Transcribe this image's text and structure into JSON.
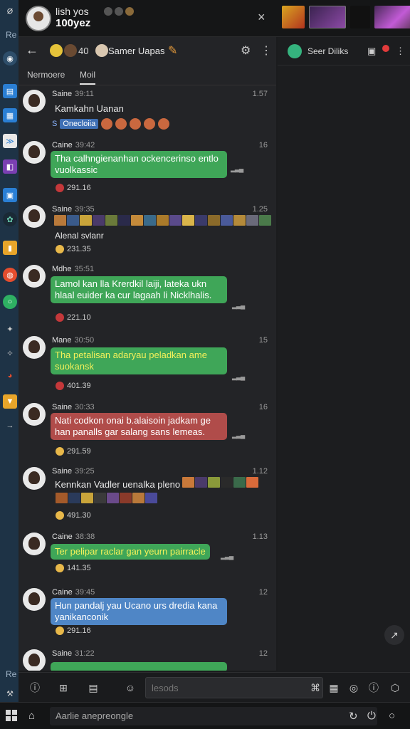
{
  "window": {
    "title": "lish yos",
    "subtitle": "100yez",
    "close_icon": "×"
  },
  "rail": {
    "top_label": "Re",
    "bottom_label": "Re"
  },
  "chat": {
    "back_icon": "←",
    "member_count": "40",
    "title": "Samer Uapas",
    "tabs": [
      "Nermoere",
      "Moil"
    ],
    "settings_icon": "⚙",
    "more_icon": "⋮"
  },
  "messages": [
    {
      "sender": "Saine",
      "time": "39:11",
      "stamp": "1.57",
      "style": "plain",
      "text": "Kamkahn Uanan",
      "tag": "Onecloiia"
    },
    {
      "sender": "Caine",
      "time": "39:42",
      "stamp": "16",
      "style": "green",
      "text": "Tha calhngienanhan ockencerinso entlo vuolkassic",
      "reaction": "291.16"
    },
    {
      "sender": "Saine",
      "time": "39:35",
      "stamp": "1.25",
      "style": "plain",
      "text": "Alenal svlanr",
      "reaction": "231.35"
    },
    {
      "sender": "Mdhe",
      "time": "35:51",
      "stamp": "",
      "style": "green",
      "text": "Lamol kan lla Krerdkil laiji, lateka ukn hlaal euider ka cur lagaah li Nicklhalis.",
      "reaction": "221.10"
    },
    {
      "sender": "Mane",
      "time": "30:50",
      "stamp": "15",
      "style": "green-yellow",
      "text": "Tha petalisan adaryau peladkan ame suokansk",
      "reaction": "401.39"
    },
    {
      "sender": "Saine",
      "time": "30:33",
      "stamp": "16",
      "style": "red",
      "text": "Nati codkon onai b.alaisoin jadkam ge han panalls gar salang sans lemeas.",
      "reaction": "291.59"
    },
    {
      "sender": "Saine",
      "time": "39:25",
      "stamp": "1.12",
      "style": "plain",
      "text": "Kennkan Vadler uenalka pleno",
      "reaction": "491.30"
    },
    {
      "sender": "Caine",
      "time": "38:38",
      "stamp": "1.13",
      "style": "green-yellow",
      "text": "Ter pelipar raclar gan yeurn pairracle",
      "reaction": "141.35"
    },
    {
      "sender": "Caine",
      "time": "39:45",
      "stamp": "12",
      "style": "blue",
      "text": "Hun pandalj yau Ucano urs dredia kana yanikanconik",
      "reaction": "291.16"
    },
    {
      "sender": "Saine",
      "time": "31:22",
      "stamp": "12",
      "style": "green",
      "text": "",
      "reaction": ""
    }
  ],
  "right_pane": {
    "title": "Seer Diliks"
  },
  "composer": {
    "placeholder": "lesods"
  },
  "taskbar": {
    "search_text": "Aarlie anepreongle"
  }
}
